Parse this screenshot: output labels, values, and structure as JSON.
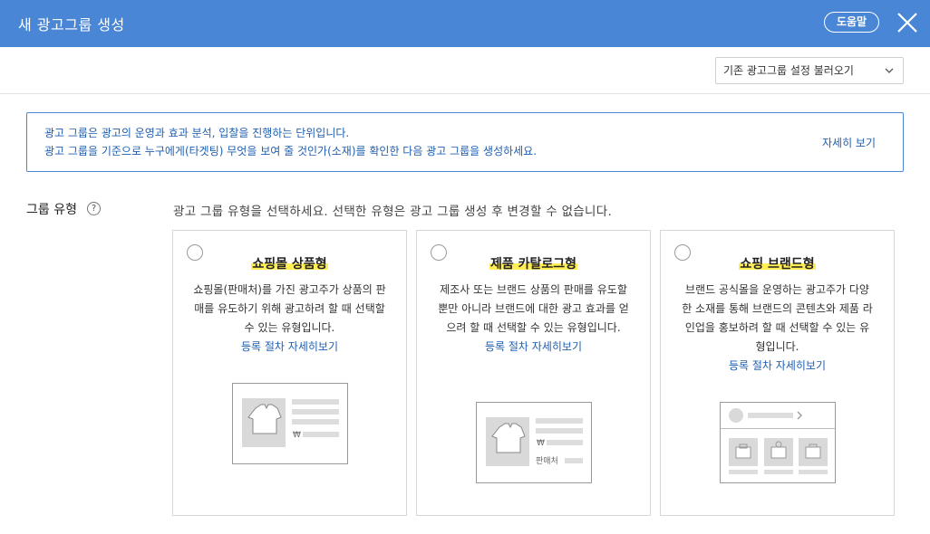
{
  "header": {
    "title": "새 광고그룹 생성",
    "help_label": "도움말"
  },
  "toolbar": {
    "load_label": "기존 광고그룹 설정 불러오기"
  },
  "info": {
    "line1": "광고 그룹은 광고의 운영과 효과 분석, 입찰을 진행하는 단위입니다.",
    "line2": "광고 그룹을 기준으로 누구에게(타겟팅) 무엇을 보여 줄 것인가(소재)를 확인한 다음 광고 그룹을 생성하세요.",
    "more_label": "자세히 보기"
  },
  "group_type": {
    "label": "그룹 유형",
    "help_glyph": "?",
    "description": "광고 그룹 유형을 선택하세요. 선택한 유형은 광고 그룹 생성 후 변경할 수 없습니다."
  },
  "cards": [
    {
      "title": "쇼핑몰 상품형",
      "desc": "쇼핑몰(판매처)를 가진 광고주가 상품의 판매를 유도하기 위해 광고하려 할 때 선택할 수 있는 유형입니다.",
      "link": "등록 절차 자세히보기",
      "illus_text": "₩"
    },
    {
      "title": "제품 카탈로그형",
      "desc": "제조사 또는 브랜드 상품의 판매를 유도할 뿐만 아니라 브랜드에 대한 광고 효과를 얻으려 할 때 선택할 수 있는 유형입니다.",
      "link": "등록 절차 자세히보기",
      "illus_text": "₩",
      "illus_text2": "판매처"
    },
    {
      "title": "쇼핑 브랜드형",
      "desc": "브랜드 공식몰을 운영하는 광고주가 다양한 소재를 통해 브랜드의 콘텐츠와 제품 라인업을 홍보하려 할 때 선택할 수 있는 유형입니다.",
      "link": "등록 절차 자세히보기"
    }
  ],
  "colors": {
    "header_bg": "#4a86d6",
    "link": "#1f5fb0",
    "highlight": "#ffee55"
  }
}
